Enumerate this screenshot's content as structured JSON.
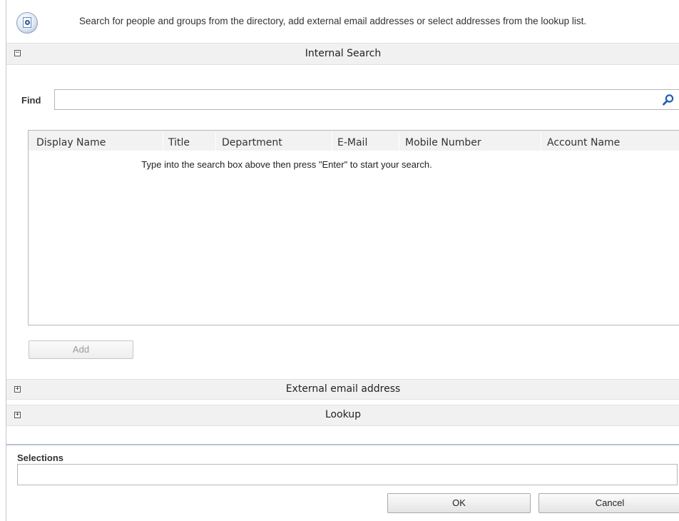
{
  "header": {
    "icon": "people-search-icon",
    "description": "Search for people and groups from the directory, add external email addresses or select addresses from the lookup list."
  },
  "sections": {
    "internal": {
      "label": "Internal Search",
      "toggle": "−",
      "expanded": true
    },
    "external": {
      "label": "External email address",
      "toggle": "+",
      "expanded": false
    },
    "lookup": {
      "label": "Lookup",
      "toggle": "+",
      "expanded": false
    }
  },
  "find": {
    "label": "Find",
    "value": "",
    "placeholder": "",
    "search_icon": "magnifier-icon"
  },
  "results": {
    "columns": [
      "Display Name",
      "Title",
      "Department",
      "E-Mail",
      "Mobile Number",
      "Account Name"
    ],
    "empty_message": "Type into the search box above then press \"Enter\" to start your search."
  },
  "add_button": {
    "label": "Add",
    "enabled": false
  },
  "selections": {
    "label": "Selections",
    "value": ""
  },
  "footer": {
    "ok_label": "OK",
    "cancel_label": "Cancel"
  },
  "colors": {
    "bar_background": "#f1f1f1",
    "separator": "#b9c3cf",
    "search_icon": "#1c5fb0"
  }
}
